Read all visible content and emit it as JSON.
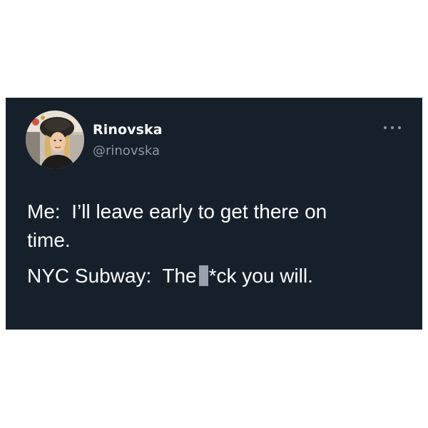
{
  "tweet": {
    "display_name": "Rinovska",
    "handle": "@rinovska",
    "more_icon": "more-horizontal-icon",
    "lines": {
      "line1": "Me:  I’ll leave early to get there on",
      "line2": "time.",
      "line3_before": "NYC Subway:  The",
      "line3_after": "*ck you will."
    }
  },
  "colors": {
    "page_background": "#ffffff",
    "card_background": "#15202b",
    "text_primary": "#ffffff",
    "text_secondary": "#8b98a5",
    "redaction_bar": "#9aa1ae"
  }
}
